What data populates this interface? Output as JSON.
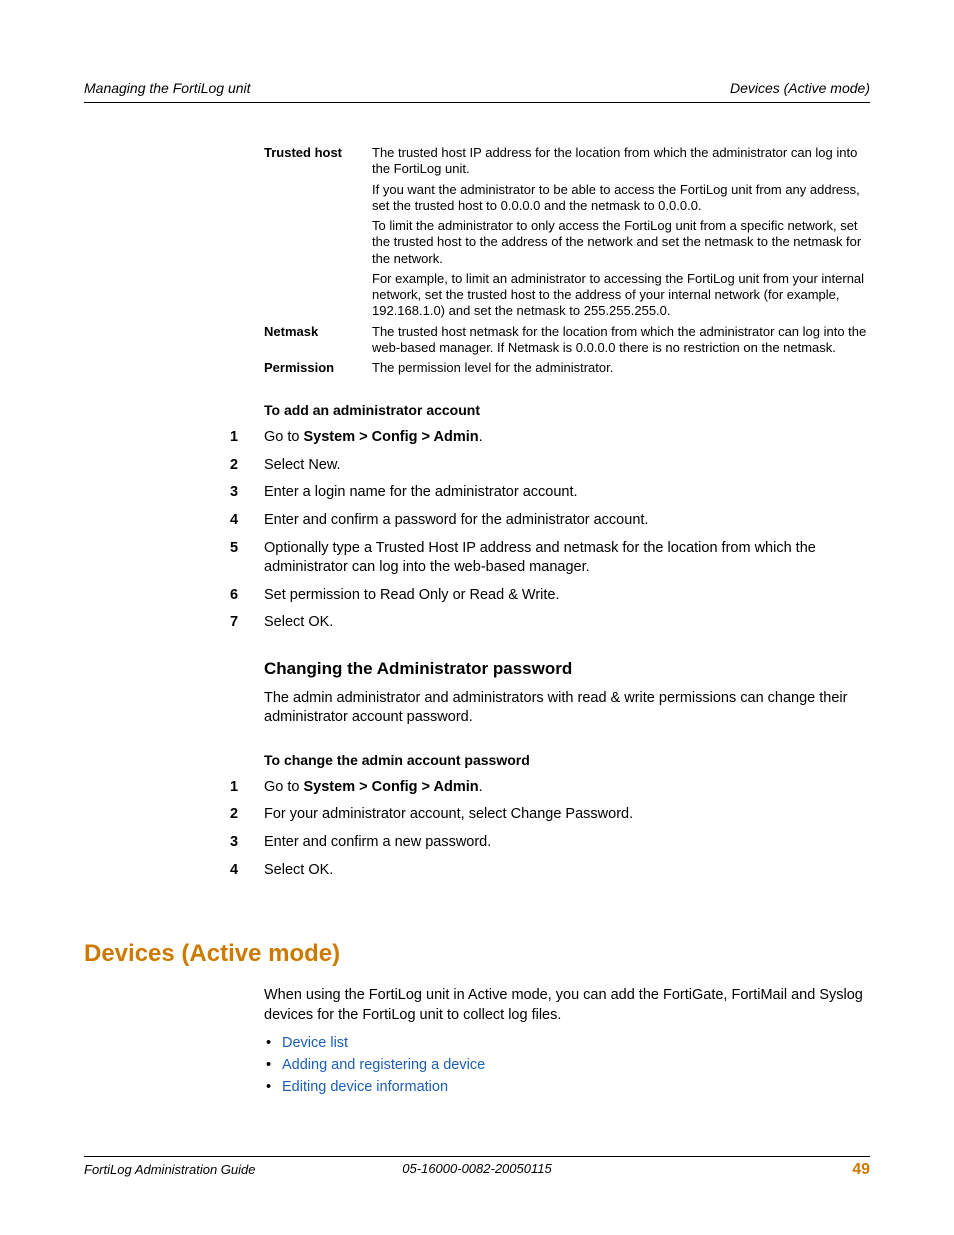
{
  "header": {
    "left": "Managing the FortiLog unit",
    "right": "Devices (Active mode)"
  },
  "definitions": [
    {
      "term": "Trusted host",
      "paras": [
        "The trusted host IP address for the location from which the administrator can log into the FortiLog unit.",
        "If you want the administrator to be able to access the FortiLog unit from any address, set the trusted host to 0.0.0.0 and the netmask to 0.0.0.0.",
        "To limit the administrator to only access the FortiLog unit from a specific network, set the trusted host to the address of the network and set the netmask to the netmask for the network.",
        "For example, to limit an administrator to accessing the FortiLog unit from your internal network, set the trusted host to the address of your internal network (for example, 192.168.1.0) and set the netmask to 255.255.255.0."
      ]
    },
    {
      "term": "Netmask",
      "paras": [
        "The trusted host netmask for the location from which the administrator can log into the web-based manager. If Netmask is 0.0.0.0 there is no restriction on the netmask."
      ]
    },
    {
      "term": "Permission",
      "paras": [
        "The permission level for the administrator."
      ]
    }
  ],
  "addAdmin": {
    "title": "To add an administrator account",
    "steps": [
      {
        "pre": "Go to ",
        "bold": "System > Config > Admin",
        "post": "."
      },
      {
        "text": "Select New."
      },
      {
        "text": "Enter a login name for the administrator account."
      },
      {
        "text": "Enter and confirm a password for the administrator account."
      },
      {
        "text": "Optionally type a Trusted Host IP address and netmask for the location from which the administrator can log into the web-based manager."
      },
      {
        "text": "Set permission to Read Only or Read & Write."
      },
      {
        "text": "Select OK."
      }
    ]
  },
  "changePw": {
    "heading": "Changing the Administrator password",
    "intro": "The admin administrator and administrators with read & write permissions can change their administrator account password.",
    "title": "To change the admin account password",
    "steps": [
      {
        "pre": "Go to ",
        "bold": "System > Config > Admin",
        "post": "."
      },
      {
        "text": "For your administrator account, select Change Password."
      },
      {
        "text": "Enter and confirm a new password."
      },
      {
        "text": "Select OK."
      }
    ]
  },
  "devices": {
    "heading": "Devices (Active mode)",
    "intro": "When using the FortiLog unit in Active mode, you can add the FortiGate, FortiMail and Syslog devices for the FortiLog unit to collect log files.",
    "links": [
      "Device list",
      "Adding and registering a device",
      "Editing device information"
    ]
  },
  "footer": {
    "left": "FortiLog Administration Guide",
    "center": "05-16000-0082-20050115",
    "page": "49"
  }
}
